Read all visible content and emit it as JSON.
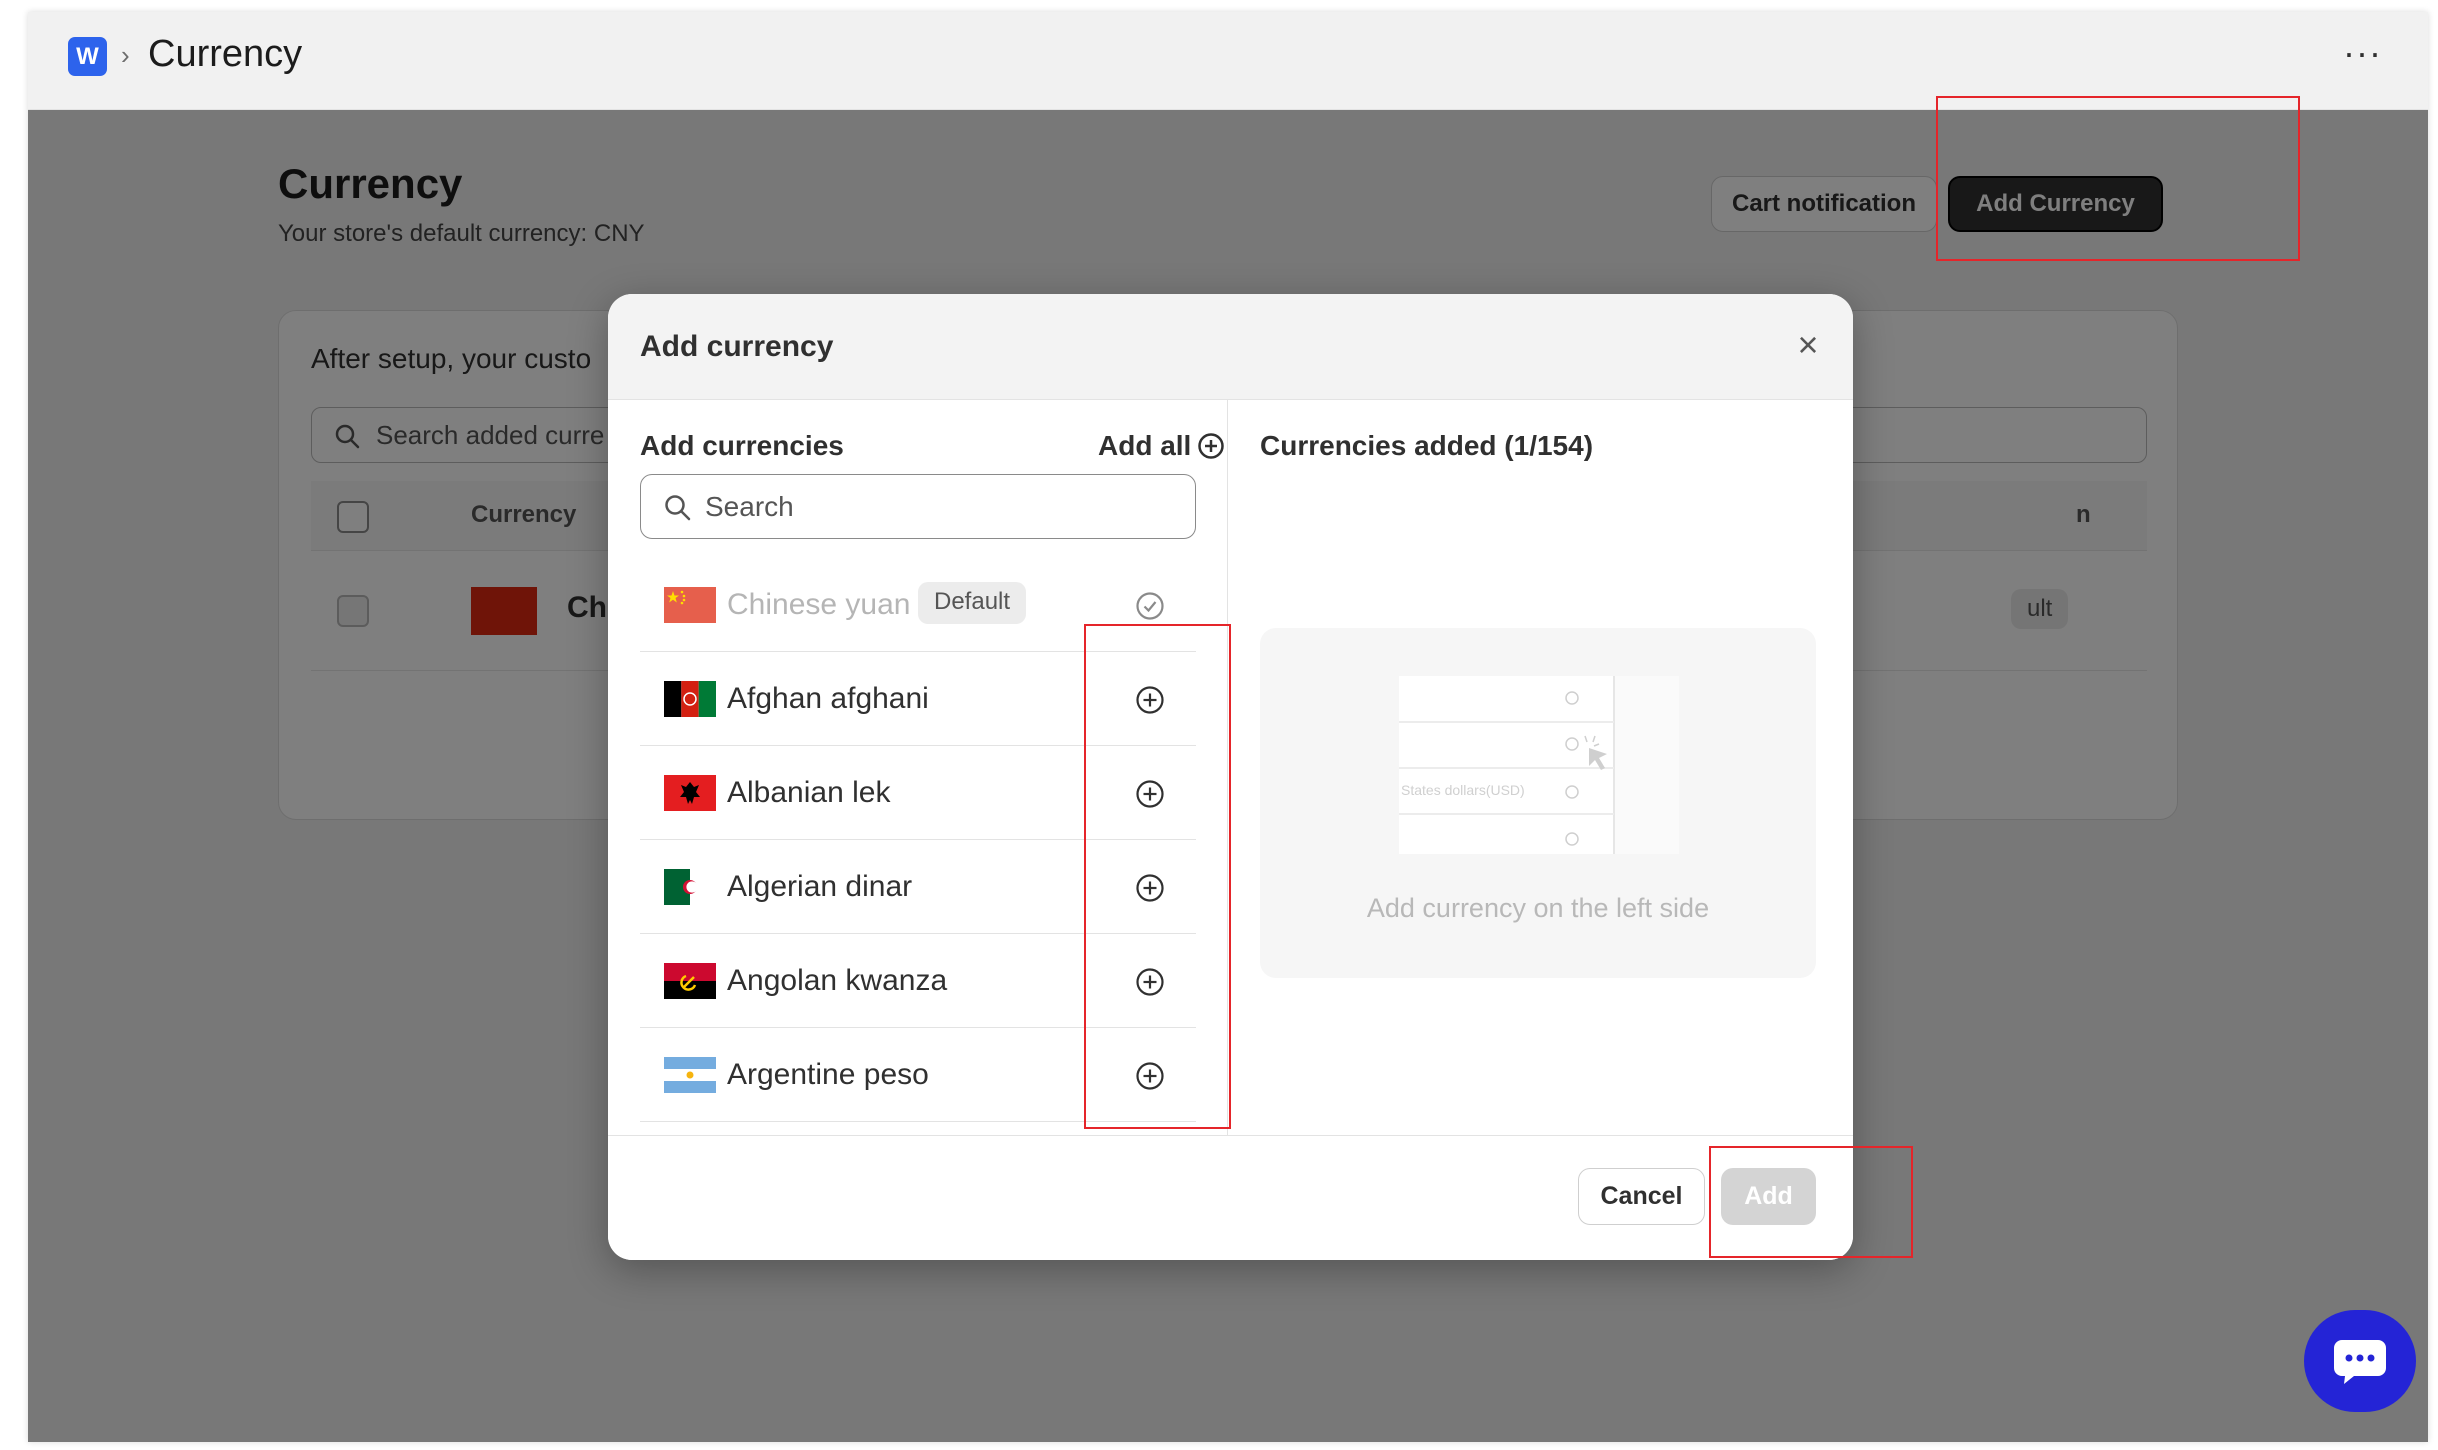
{
  "topbar": {
    "breadcrumb_separator": "›",
    "title": "Currency",
    "more_label": "···"
  },
  "page": {
    "title": "Currency",
    "subtitle": "Your store's default currency: CNY",
    "cart_notification_label": "Cart notification",
    "add_currency_label": "Add Currency"
  },
  "card": {
    "intro_text": "After setup, your custo",
    "search_placeholder": "Search added curre",
    "column_currency": "Currency",
    "column_last": "n",
    "row_name": "Chi",
    "row_badge": "ult"
  },
  "modal": {
    "title": "Add currency",
    "close_label": "×",
    "left_heading": "Add currencies",
    "add_all_label": "Add all",
    "search_placeholder": "Search",
    "right_heading": "Currencies added (1/154)",
    "empty_hint": "Add currency on the left side",
    "illustration_text": "States dollars(USD)",
    "cancel_label": "Cancel",
    "add_label": "Add",
    "currencies": [
      {
        "name": "Chinese yuan",
        "badge": "Default",
        "state": "added",
        "flag": "cn"
      },
      {
        "name": "Afghan afghani",
        "state": "available",
        "flag": "af"
      },
      {
        "name": "Albanian lek",
        "state": "available",
        "flag": "al"
      },
      {
        "name": "Algerian dinar",
        "state": "available",
        "flag": "dz"
      },
      {
        "name": "Angolan kwanza",
        "state": "available",
        "flag": "ao"
      },
      {
        "name": "Argentine peso",
        "state": "available",
        "flag": "ar"
      }
    ]
  },
  "colors": {
    "primary_button": "#303030",
    "chat_button": "#2424d6",
    "brand_logo": "#2d63ec",
    "highlight_box": "#e5252a"
  }
}
